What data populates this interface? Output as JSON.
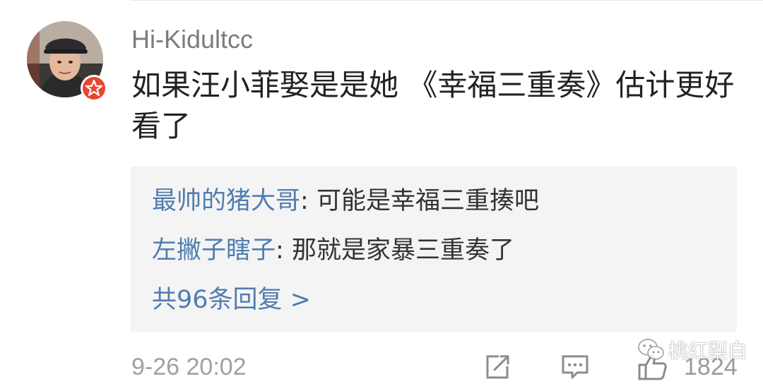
{
  "comment": {
    "username": "Hi-Kidultcc",
    "text": "如果汪小菲娶是是她 《幸福三重奏》估计更好看了",
    "timestamp": "9-26 20:02",
    "likes": "1824"
  },
  "replies": [
    {
      "author": "最帅的猪大哥",
      "separator": ": ",
      "text": "可能是幸福三重揍吧"
    },
    {
      "author": "左撇子瞎子",
      "separator": ": ",
      "text": "那就是家暴三重奏了"
    }
  ],
  "more_replies_label": "共96条回复 >",
  "watermark": {
    "text": "桃红梨白"
  },
  "icons": {
    "avatar_badge": "star-badge-icon",
    "share": "share-icon",
    "reply": "comment-icon",
    "like": "thumbs-up-icon",
    "watermark": "wechat-icon"
  },
  "colors": {
    "link_blue": "#507daf",
    "text_dark": "#222222",
    "text_gray": "#7c7c7c",
    "reply_bg": "#f4f4f4",
    "badge_red": "#e8452f"
  }
}
